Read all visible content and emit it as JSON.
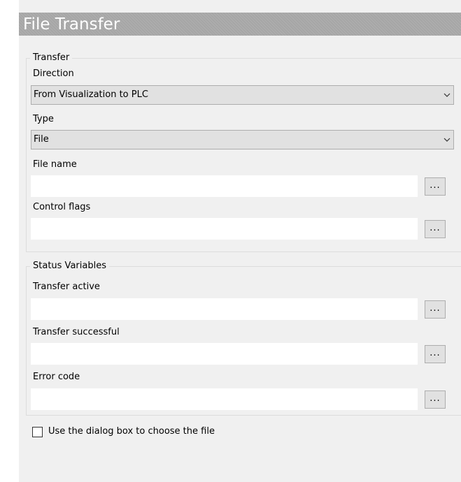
{
  "window": {
    "title": "File Transfer"
  },
  "transfer_group": {
    "legend": "Transfer",
    "direction": {
      "label": "Direction",
      "value": "From Visualization to PLC"
    },
    "type": {
      "label": "Type",
      "value": "File"
    },
    "file_name": {
      "label": "File name",
      "value": "",
      "button": "..."
    },
    "control_flags": {
      "label": "Control flags",
      "value": "",
      "button": "..."
    }
  },
  "status_group": {
    "legend": "Status Variables",
    "transfer_active": {
      "label": "Transfer active",
      "value": "",
      "button": "..."
    },
    "transfer_successful": {
      "label": "Transfer successful",
      "value": "",
      "button": "..."
    },
    "error_code": {
      "label": "Error code",
      "value": "",
      "button": "..."
    }
  },
  "dialog_option": {
    "label": "Use the dialog box to choose the file",
    "checked": false
  },
  "icons": {
    "dropdown": "chevron-down-icon"
  },
  "colors": {
    "title_bar": "#a6a6a6",
    "panel": "#f0f0f0",
    "control": "#e1e1e1"
  }
}
